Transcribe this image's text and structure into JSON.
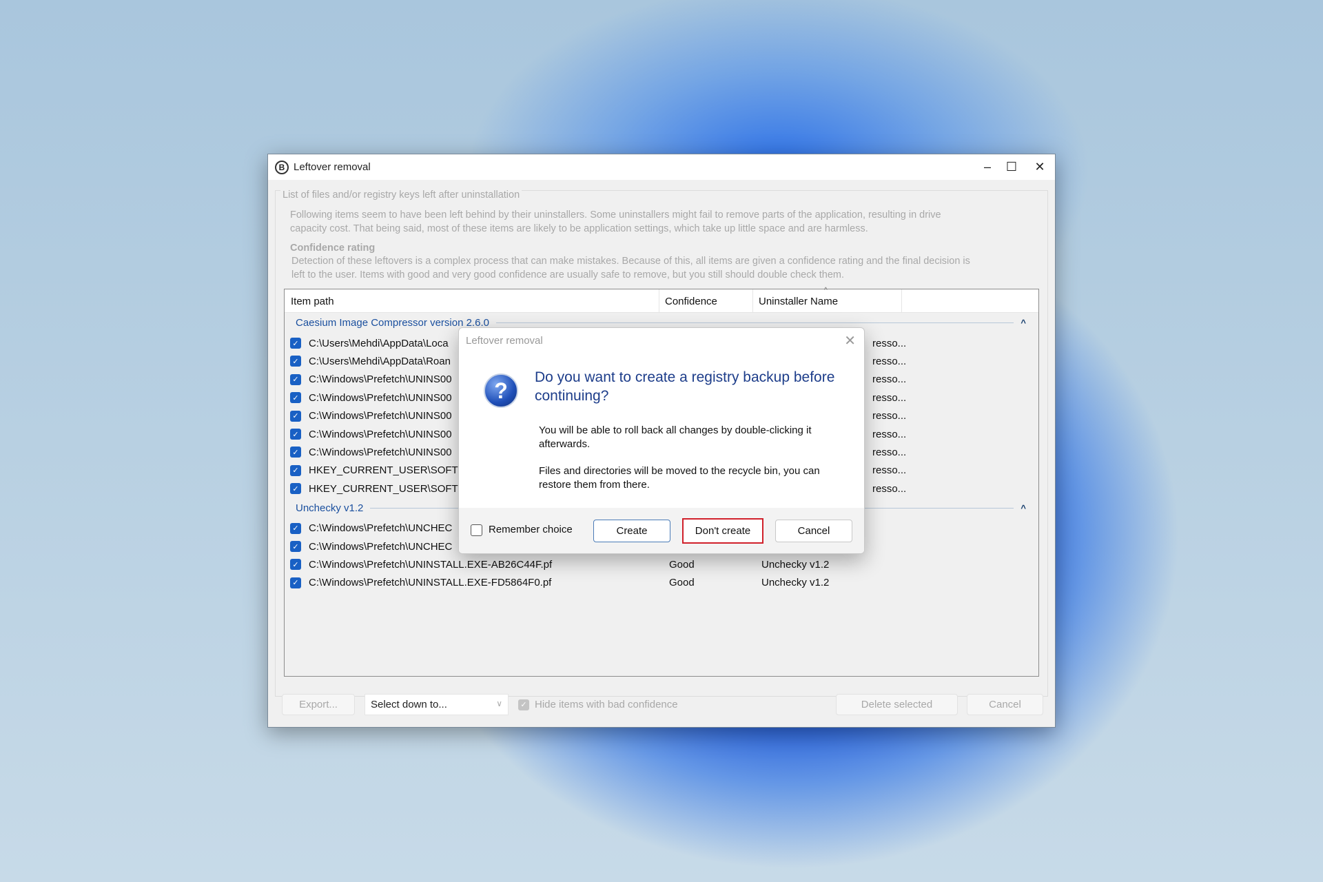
{
  "window": {
    "title": "Leftover removal",
    "group_label": "List of files and/or registry keys left after uninstallation",
    "description": [
      "Following items seem to have been left behind by their uninstallers. Some uninstallers might fail to remove parts of the application, resulting in drive",
      "capacity cost. That being said, most of these items are likely to be application settings, which take up little space and are harmless."
    ],
    "confidence_heading": "Confidence rating",
    "confidence_text": [
      "Detection of these leftovers is a complex process that can make mistakes. Because of this, all items are given a confidence rating and the final decision is",
      "left to the user. Items with good and very good confidence are usually safe to remove, but you still should double check them."
    ]
  },
  "list": {
    "columns": [
      "Item path",
      "Confidence",
      "Uninstaller Name"
    ],
    "groups": [
      {
        "name": "Caesium Image Compressor version 2.6.0",
        "items": [
          {
            "path": "C:\\Users\\Mehdi\\AppData\\Loca",
            "uninstaller": "resso..."
          },
          {
            "path": "C:\\Users\\Mehdi\\AppData\\Roan",
            "uninstaller": "resso..."
          },
          {
            "path": "C:\\Windows\\Prefetch\\UNINS00",
            "uninstaller": "resso..."
          },
          {
            "path": "C:\\Windows\\Prefetch\\UNINS00",
            "uninstaller": "resso..."
          },
          {
            "path": "C:\\Windows\\Prefetch\\UNINS00",
            "uninstaller": "resso..."
          },
          {
            "path": "C:\\Windows\\Prefetch\\UNINS00",
            "uninstaller": "resso..."
          },
          {
            "path": "C:\\Windows\\Prefetch\\UNINS00",
            "uninstaller": "resso..."
          },
          {
            "path": "HKEY_CURRENT_USER\\SOFTWA",
            "uninstaller": "resso..."
          },
          {
            "path": "HKEY_CURRENT_USER\\SOFTWA",
            "uninstaller": "resso..."
          }
        ]
      },
      {
        "name": "Unchecky v1.2",
        "items": [
          {
            "path": "C:\\Windows\\Prefetch\\UNCHEC"
          },
          {
            "path": "C:\\Windows\\Prefetch\\UNCHEC"
          },
          {
            "path": "C:\\Windows\\Prefetch\\UNINSTALL.EXE-AB26C44F.pf",
            "confidence": "Good",
            "uninstaller": "Unchecky v1.2"
          },
          {
            "path": "C:\\Windows\\Prefetch\\UNINSTALL.EXE-FD5864F0.pf",
            "confidence": "Good",
            "uninstaller": "Unchecky v1.2"
          }
        ]
      }
    ]
  },
  "footer": {
    "export": "Export...",
    "select_down": "Select down to...",
    "hide_bad": "Hide items with bad confidence",
    "delete": "Delete selected",
    "cancel": "Cancel"
  },
  "dialog": {
    "title": "Leftover removal",
    "question": [
      "Do you want to create a registry backup before",
      "continuing?"
    ],
    "body1": [
      "You will be able to roll back all changes by double-clicking it",
      "afterwards."
    ],
    "body2": [
      "Files and directories will be moved to the recycle bin, you can",
      "restore them from there."
    ],
    "remember": "Remember choice",
    "create": "Create",
    "dont_create": "Don't create",
    "cancel": "Cancel"
  },
  "colors": {
    "accent": "#1960c4",
    "highlight_border": "#d0202a",
    "group_text": "#1a4f9e"
  }
}
